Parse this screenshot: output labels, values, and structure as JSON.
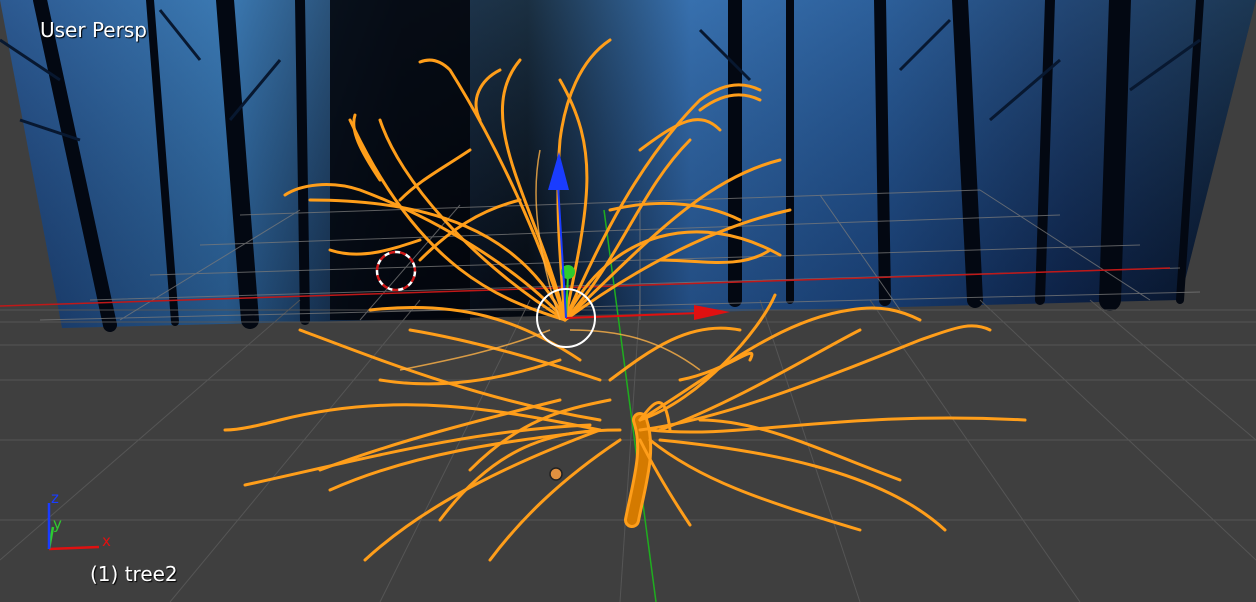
{
  "viewport": {
    "view_name": "User Persp",
    "object_info": "(1) tree2"
  },
  "axis_gizmo": {
    "x_label": "x",
    "y_label": "y",
    "z_label": "z"
  },
  "colors": {
    "selection": "#ff9e1a",
    "x_axis": "#e01010",
    "y_axis": "#2ecc2e",
    "z_axis": "#1a3cff",
    "grid_floor": "#3f3f3f",
    "grid_line": "#545454",
    "backdrop": "#10224a"
  },
  "icons": {
    "transform_widget": "manipulator-icon",
    "cursor_3d": "3d-cursor-icon",
    "origin": "origin-dot-icon"
  }
}
